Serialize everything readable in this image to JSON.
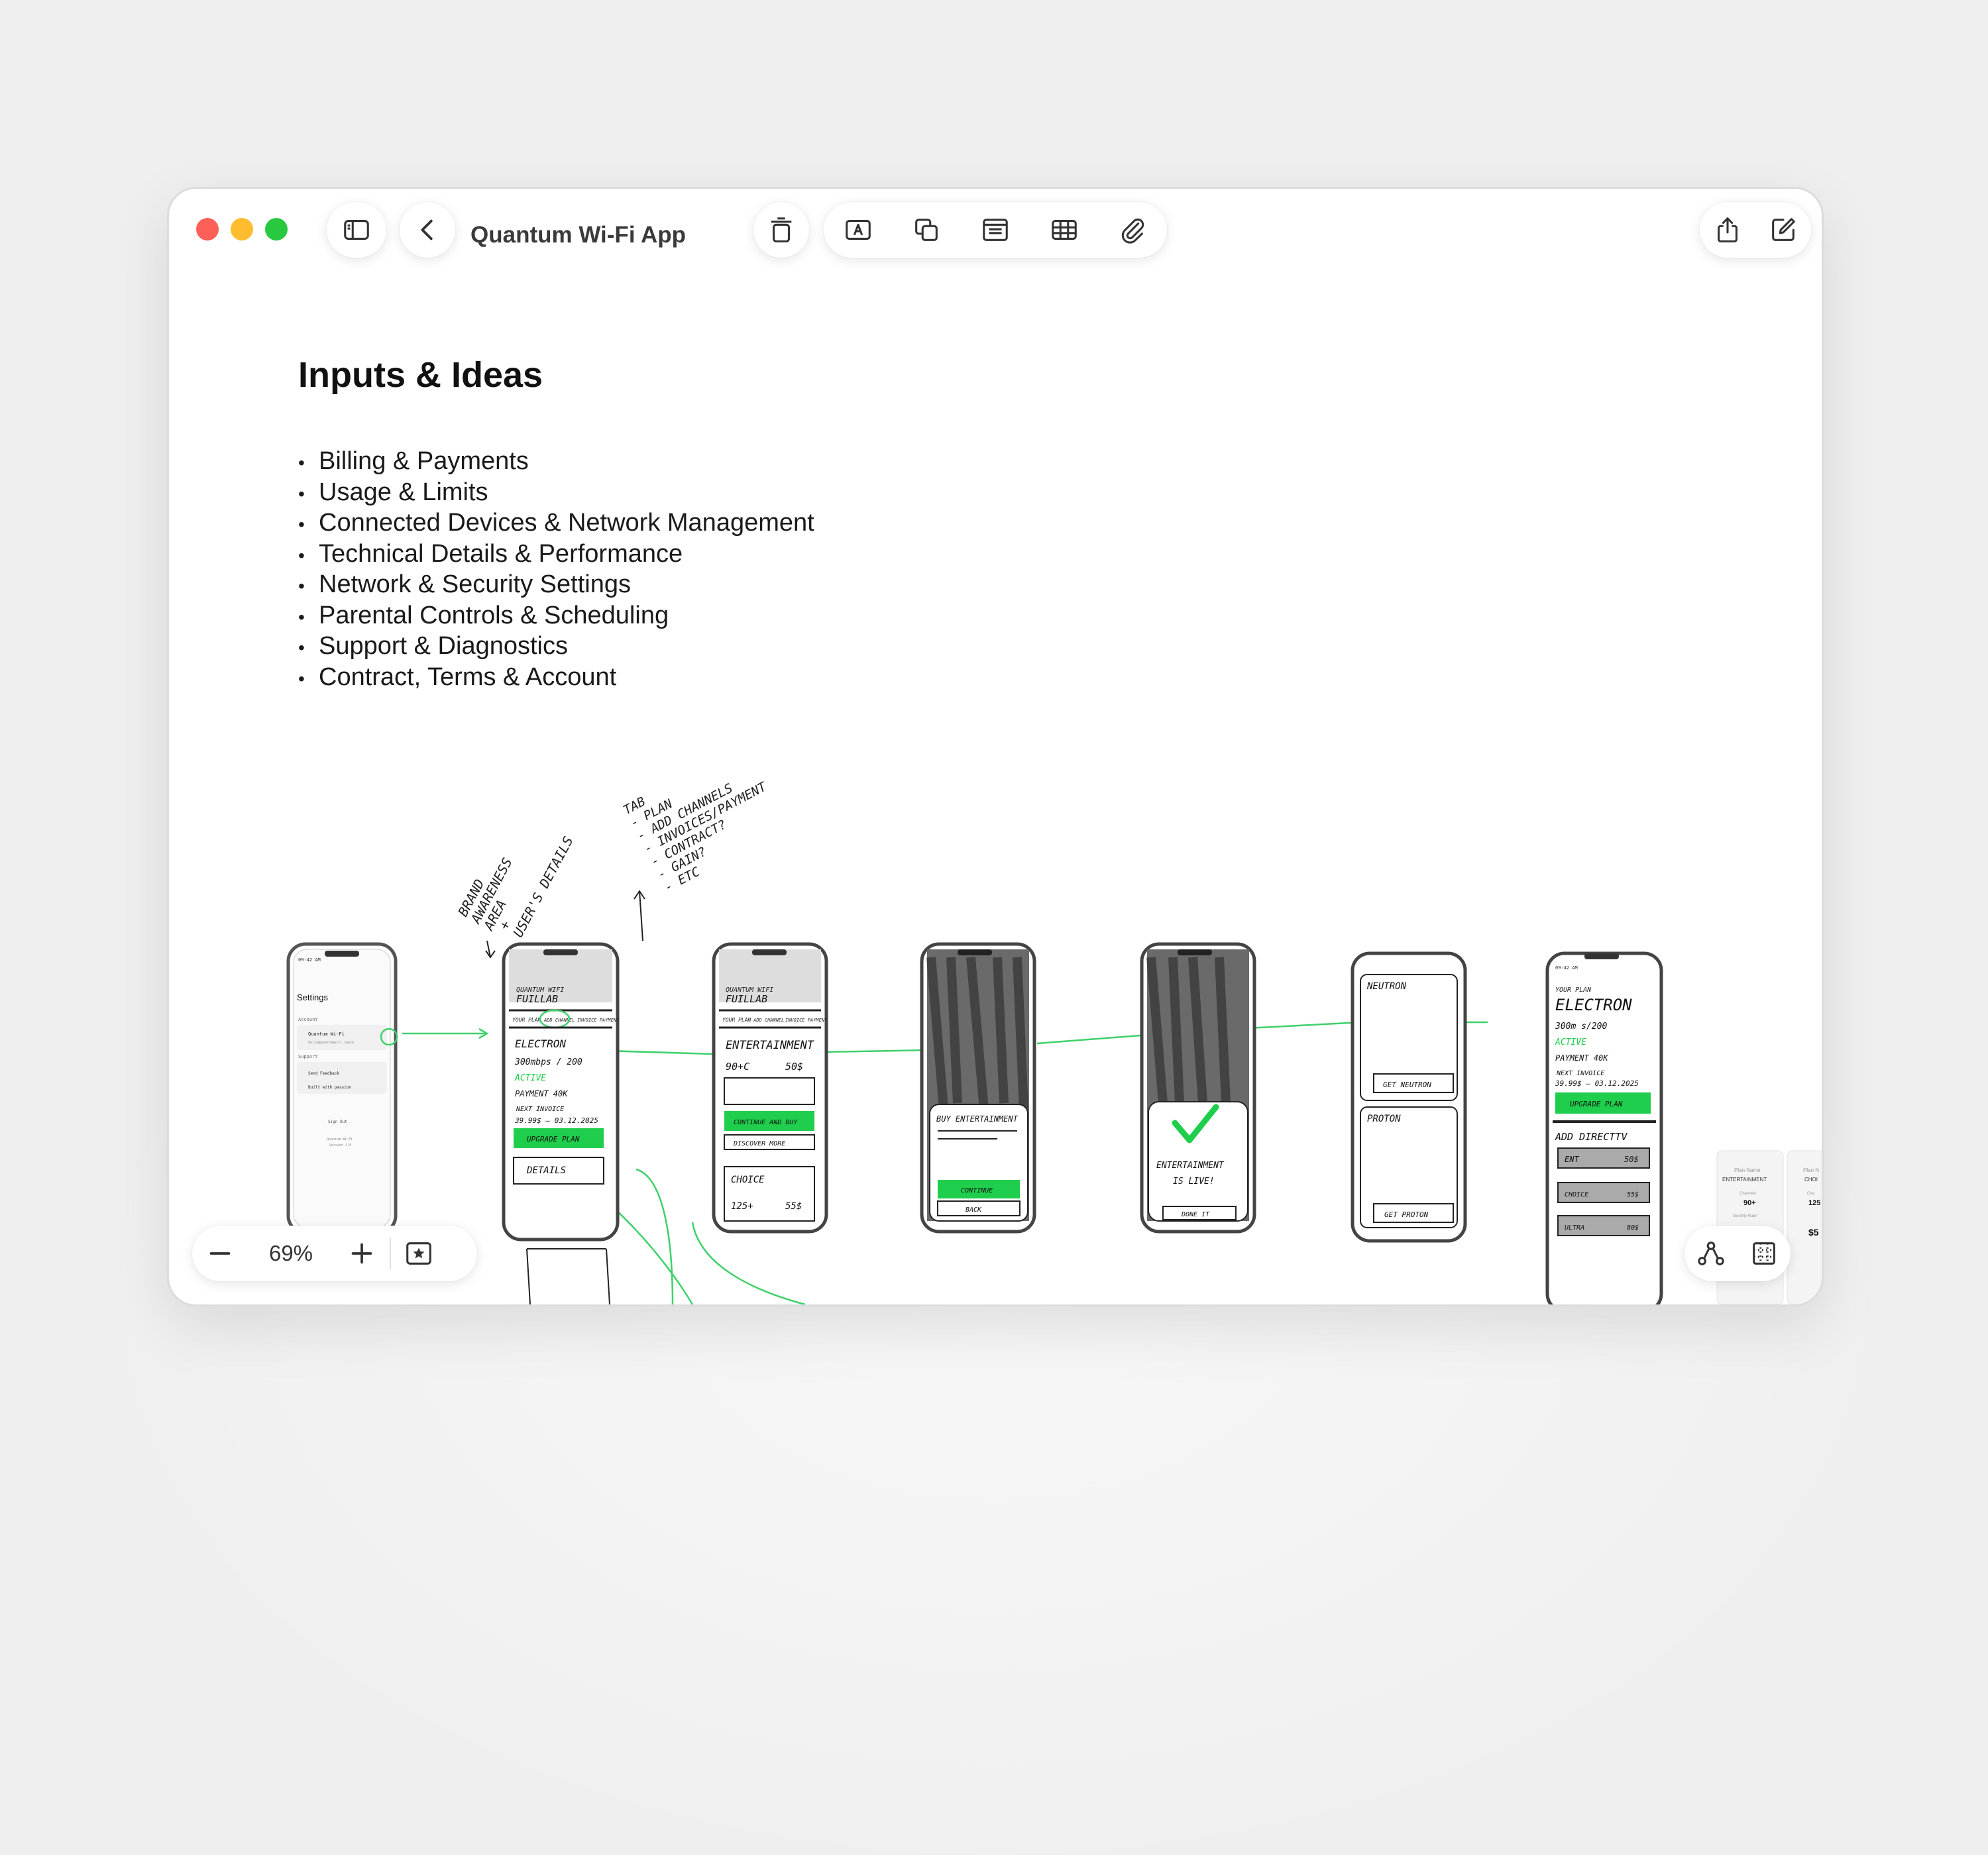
{
  "window": {
    "title": "Quantum Wi-Fi App"
  },
  "toolbar": {
    "left_icons": [
      "sidebar-toggle-icon",
      "back-chevron-icon"
    ],
    "insert_icons": [
      "trash-icon",
      "text-box-icon",
      "shapes-icon",
      "media-icon",
      "table-icon",
      "attachment-icon"
    ],
    "right_icons": [
      "share-icon",
      "compose-icon"
    ]
  },
  "content": {
    "heading": "Inputs & Ideas",
    "ideas": [
      "Billing & Payments",
      "Usage & Limits",
      "Connected Devices & Network Management",
      "Technical Details & Performance",
      "Network & Security Settings",
      "Parental Controls & Scheduling",
      "Support & Diagnostics",
      "Contract, Terms & Account"
    ]
  },
  "sketches": {
    "annotations": {
      "brand": [
        "BRAND",
        "AWARENESS",
        "AREA"
      ],
      "user": [
        "+",
        "USER'S DETAILS"
      ],
      "tab": [
        "TAB",
        "- PLAN",
        "- ADD CHANNELS",
        "- INVOICES/PAYMENT",
        "- CONTRACT?",
        "- GAIN?",
        "- ETC"
      ]
    },
    "phone1": {
      "status": "09:42 AM",
      "title": "Settings",
      "section_account": "Account",
      "account_name": "Quantum Wi-Fi",
      "account_sub": "hello@quantumwifi.space",
      "section_support": "Support",
      "support_items": [
        "Send Feedback",
        "Built with passion"
      ],
      "sign_out": "Sign Out",
      "footer": [
        "Quantum Wi-Fi",
        "Version 1.0"
      ]
    },
    "phone2": {
      "brand": [
        "QUANTUM WIFI",
        "FUILLAB"
      ],
      "tabs": [
        "YOUR PLAN",
        "ADD CHANNEL",
        "INVOICE PAYMENT"
      ],
      "plan": "ELECTRON",
      "speed": "300mbps / 200",
      "status": "ACTIVE",
      "payment": "PAYMENT 40K",
      "invoice": [
        "NEXT INVOICE",
        "39.99$ — 03.12.2025"
      ],
      "cta": "UPGRADE PLAN",
      "details": "DETAILS"
    },
    "phone3": {
      "brand": [
        "QUANTUM WIFI",
        "FUILLAB"
      ],
      "tabs": [
        "YOUR PLAN",
        "ADD CHANNEL",
        "INVOICE PAYMENT"
      ],
      "item": "ENTERTAINMENT",
      "channels": "90+C",
      "price": "50$",
      "cta": "CONTINUE AND BUY",
      "secondary": "DISCOVER MORE",
      "choice": "CHOICE",
      "choice_channels": "125+",
      "choice_price": "55$"
    },
    "phone4": {
      "sheet_title": "BUY ENTERTAINMENT",
      "cta": "CONTINUE",
      "back": "BACK"
    },
    "phone5": {
      "message": [
        "ENTERTAINMENT",
        "IS LIVE!"
      ],
      "cta": "DONE IT"
    },
    "phone6": {
      "plans": [
        "NEUTRON",
        "PROTON"
      ],
      "ctas": [
        "GET NEUTRON",
        "GET PROTON"
      ]
    },
    "phone7": {
      "status": "09:42 AM",
      "label": "YOUR PLAN",
      "plan": "ELECTRON",
      "speed": "300m s/200",
      "status_text": "ACTIVE",
      "payment": "PAYMENT 40K",
      "invoice": [
        "NEXT INVOICE",
        "39.99$ — 03.12.2025"
      ],
      "cta": "UPGRADE PLAN",
      "section": "ADD DIRECTTV",
      "rows": [
        {
          "name": "ENT",
          "price": "50$"
        },
        {
          "name": "CHOICE",
          "price": "55$"
        },
        {
          "name": "ULTRA",
          "price": "80$"
        }
      ]
    },
    "mini_cards": [
      {
        "label": "Plan Name",
        "name": "ENTERTAINMENT",
        "sub": "Channels",
        "count": "90+",
        "price_label": "Monthly Rate*"
      },
      {
        "label": "Plan N",
        "name": "CHOI",
        "sub": "Cha",
        "count": "125",
        "price": "$5"
      }
    ]
  },
  "zoom": {
    "value": "69%"
  },
  "colors": {
    "accent_green": "#1fce4c",
    "flow_line": "#3fd06a",
    "traffic_red": "#fe5f57",
    "traffic_yellow": "#febc2e",
    "traffic_green": "#28c840"
  }
}
